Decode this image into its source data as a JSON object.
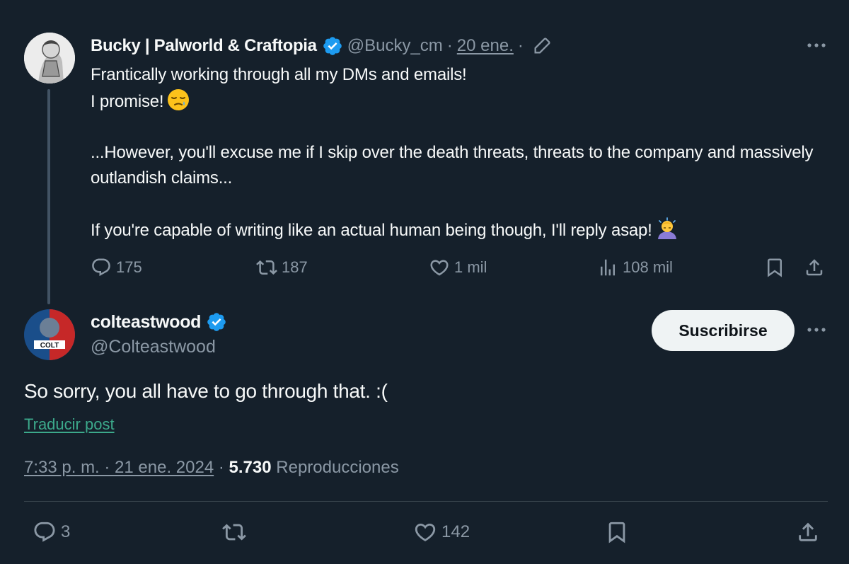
{
  "parent_tweet": {
    "author_name": "Bucky | Palworld & Craftopia",
    "handle": "@Bucky_cm",
    "separator": "·",
    "date": "20 ene.",
    "body_line1": "Frantically working through all my DMs and emails!",
    "body_line2": "I promise!",
    "body_para2": "...However, you'll excuse me if I skip over the death threats, threats to the company and massively outlandish claims...",
    "body_para3": "If you're capable of writing like an actual human being though, I'll reply asap!",
    "stats": {
      "replies": "175",
      "reposts": "187",
      "likes": "1 mil",
      "views": "108 mil"
    }
  },
  "main_tweet": {
    "author_name": "colteastwood",
    "handle": "@Colteastwood",
    "subscribe_label": "Suscribirse",
    "text": "So sorry, you all have to go through that. :(",
    "translate_label": "Traducir post",
    "timestamp": "7:33 p. m. · 21 ene. 2024",
    "views_count": "5.730",
    "views_label": "Reproducciones",
    "stats": {
      "replies": "3",
      "likes": "142"
    }
  },
  "colors": {
    "background": "#15202b",
    "text": "#f7f9f9",
    "muted": "#8b98a5",
    "verified": "#1d9bf0"
  }
}
